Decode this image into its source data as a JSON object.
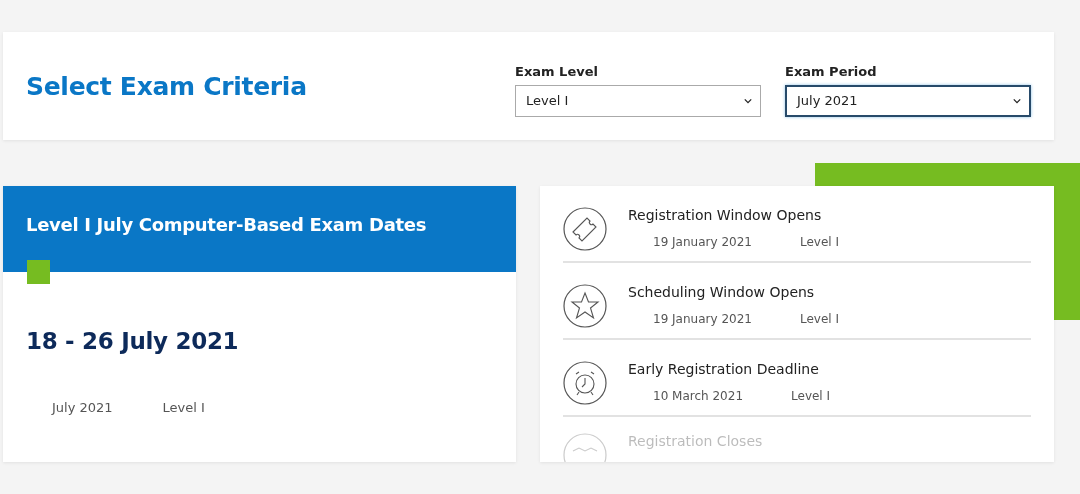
{
  "criteria": {
    "title": "Select Exam Criteria",
    "filters": [
      {
        "label": "Exam Level",
        "value": "Level I",
        "focused": false
      },
      {
        "label": "Exam Period",
        "value": "July 2021",
        "focused": true
      }
    ]
  },
  "exam_card": {
    "title": "Level I July Computer-Based Exam Dates",
    "dates": "18 - 26 July 2021",
    "period": "July 2021",
    "level": "Level I"
  },
  "milestones": [
    {
      "kind": "ticket",
      "title": "Registration Window Opens",
      "date": "19 January 2021",
      "level": "Level I",
      "faded": false
    },
    {
      "kind": "star",
      "title": "Scheduling Window Opens",
      "date": "19 January 2021",
      "level": "Level I",
      "faded": false
    },
    {
      "kind": "clock",
      "title": "Early Registration Deadline",
      "date": "10 March 2021",
      "level": "Level I",
      "faded": false
    },
    {
      "kind": "handshake",
      "title": "Registration Closes",
      "faded": true
    }
  ]
}
